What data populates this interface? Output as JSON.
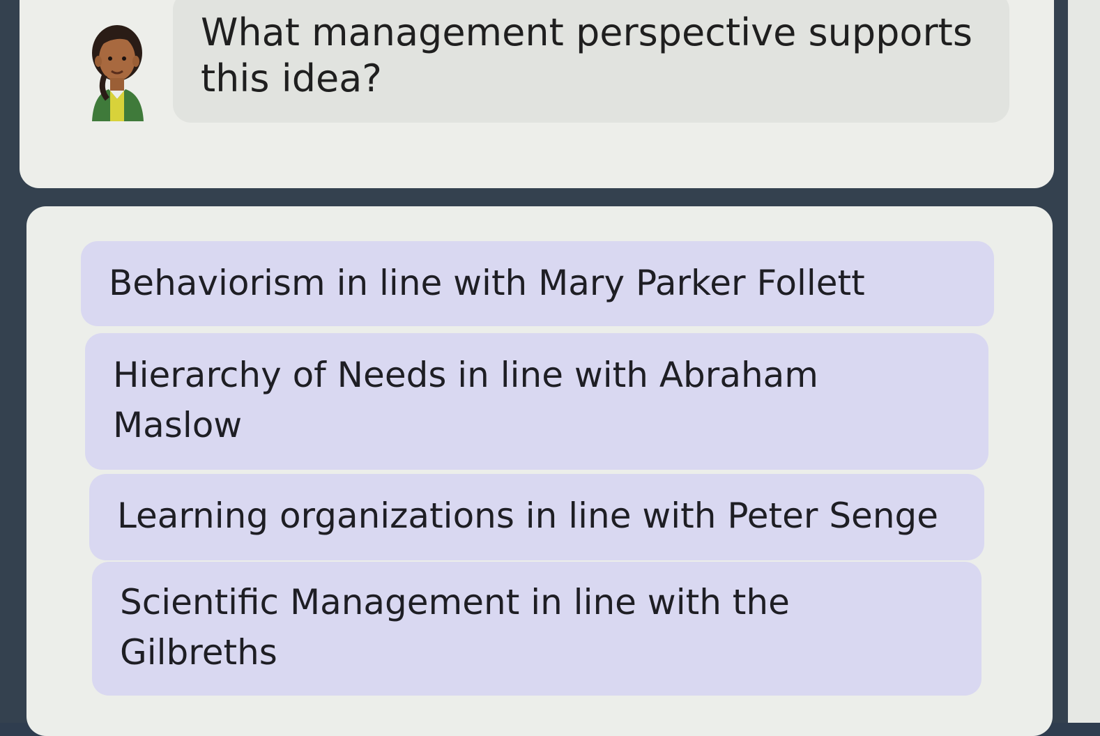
{
  "question": {
    "text": "What management perspective supports this idea?",
    "avatar_icon": "tutor-avatar-icon"
  },
  "options": [
    {
      "label": "Behaviorism in line with Mary Parker Follett"
    },
    {
      "label": "Hierarchy of Needs in line with Abraham Maslow"
    },
    {
      "label": "Learning organizations in line with Peter Senge"
    },
    {
      "label": "Scientific Management in line with the Gilbreths"
    }
  ],
  "colors": {
    "frame": "#34414f",
    "card": "#edeeea",
    "bubble": "#e1e3df",
    "option_bg": "#d9d8f1",
    "text": "#1e1e24"
  }
}
